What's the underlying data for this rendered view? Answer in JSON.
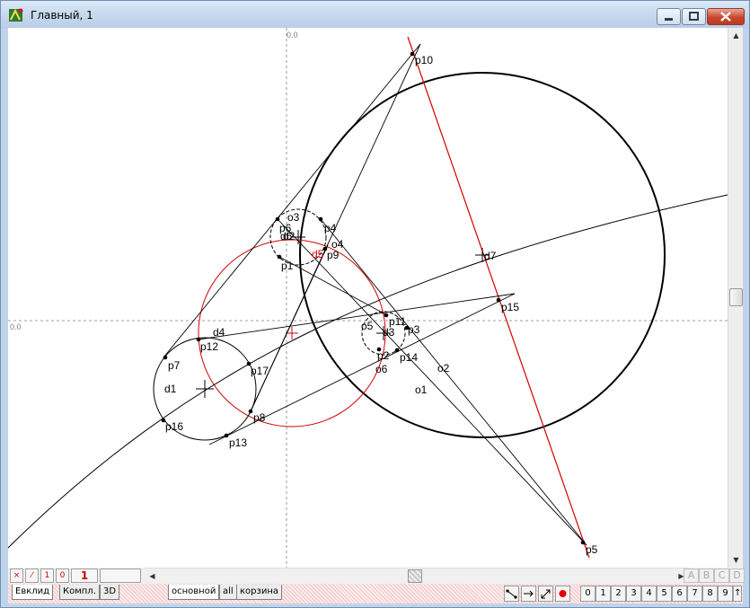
{
  "window": {
    "title": "Главный, 1"
  },
  "canvas": {
    "origin_x_label": "0.0",
    "origin_y_label": "0.0",
    "points": [
      "p1",
      "p2",
      "p3",
      "p4",
      "p5",
      "p6",
      "p7",
      "p8",
      "p9",
      "p10",
      "p11",
      "p12",
      "p13",
      "p14",
      "p15",
      "p16",
      "p17"
    ],
    "lines": [
      "d1",
      "d2",
      "d3",
      "d4",
      "d5",
      "d6",
      "d7"
    ],
    "circles": [
      "o1",
      "o2",
      "o3",
      "o4",
      "o5",
      "o6"
    ]
  },
  "bottombar": {
    "tool_buttons": [
      "×",
      "⁄",
      "1",
      "0",
      "1"
    ],
    "letter_buttons": [
      "A",
      "B",
      "C",
      "D"
    ]
  },
  "tabs": {
    "left": [
      "Евклид",
      "Компл.",
      "3D"
    ],
    "layers": [
      "основной",
      "all",
      "корзина"
    ]
  },
  "toolbar": {
    "numbers": [
      "0",
      "1",
      "2",
      "3",
      "4",
      "5",
      "6",
      "7",
      "8",
      "9",
      "↑"
    ]
  },
  "colors": {
    "construction": "#d40000",
    "line": "#000000",
    "axis": "#808080"
  }
}
